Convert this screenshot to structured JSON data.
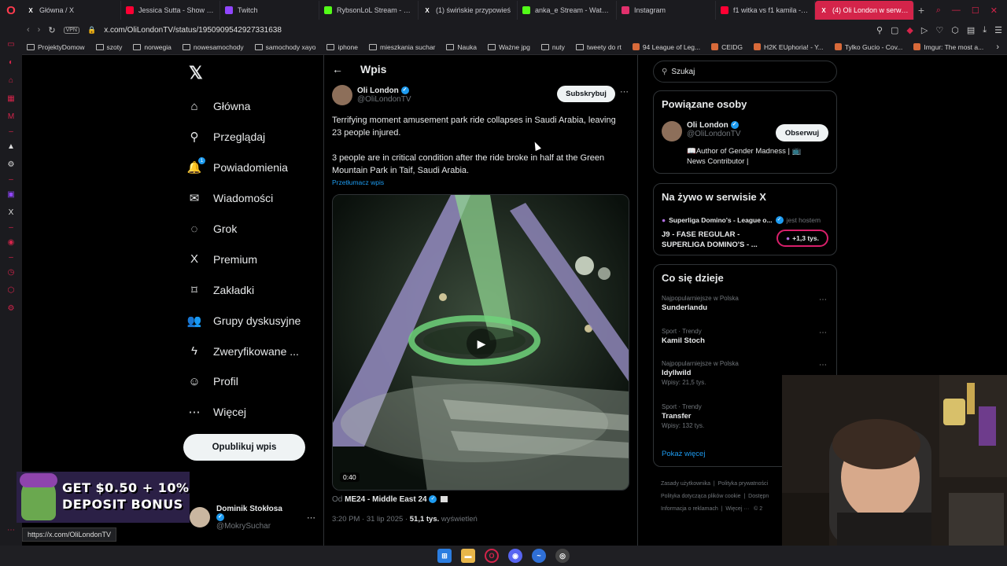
{
  "browser": {
    "tabs": [
      {
        "label": "Główna / X",
        "icon": "x-logo-icon",
        "color": "#ffffff",
        "active": false
      },
      {
        "label": "Jessica Sutta - Show Me",
        "icon": "youtube-icon",
        "color": "#ff0033",
        "active": false
      },
      {
        "label": "Twitch",
        "icon": "twitch-icon",
        "color": "#9146ff",
        "active": false
      },
      {
        "label": "RybsonLoL Stream - Wat",
        "icon": "kick-icon",
        "color": "#53fc18",
        "active": false
      },
      {
        "label": "(1) świńskie przypowieś",
        "icon": "x-logo-icon",
        "color": "#ffffff",
        "active": false
      },
      {
        "label": "anka_e Stream - Watch L",
        "icon": "kick-icon",
        "color": "#53fc18",
        "active": false
      },
      {
        "label": "Instagram",
        "icon": "instagram-icon",
        "color": "#e1306c",
        "active": false
      },
      {
        "label": "f1 witka vs f1 kamila - Yo",
        "icon": "youtube-icon",
        "color": "#ff0033",
        "active": false
      },
      {
        "label": "(4) Oli London w serwisie",
        "icon": "x-logo-icon",
        "color": "#ffffff",
        "active": true
      }
    ],
    "vpn_label": "VPN",
    "url": "x.com/OliLondonTV/status/1950909542927331638",
    "bookmarks": [
      {
        "label": "ProjektyDomow",
        "type": "folder"
      },
      {
        "label": "szoty",
        "type": "folder"
      },
      {
        "label": "norwegia",
        "type": "folder"
      },
      {
        "label": "nowesamochody",
        "type": "folder"
      },
      {
        "label": "samochody xayo",
        "type": "folder"
      },
      {
        "label": "iphone",
        "type": "folder"
      },
      {
        "label": "mieszkania suchar",
        "type": "folder"
      },
      {
        "label": "Nauka",
        "type": "folder"
      },
      {
        "label": "Ważne jpg",
        "type": "folder"
      },
      {
        "label": "nuty",
        "type": "folder"
      },
      {
        "label": "tweety do rt",
        "type": "folder"
      },
      {
        "label": "94 League of Leg...",
        "type": "site"
      },
      {
        "label": "CEIDG",
        "type": "site"
      },
      {
        "label": "H2K EUphoria! - Y...",
        "type": "site"
      },
      {
        "label": "Tylko Gucio - Cov...",
        "type": "site"
      },
      {
        "label": "Imgur: The most a...",
        "type": "site"
      }
    ],
    "status_link": "https://x.com/OliLondonTV"
  },
  "nav": {
    "items": [
      {
        "label": "Główna",
        "icon": "home-icon",
        "glyph": "⌂"
      },
      {
        "label": "Przeglądaj",
        "icon": "search-icon",
        "glyph": "⚲"
      },
      {
        "label": "Powiadomienia",
        "icon": "bell-icon",
        "glyph": "🔔",
        "badge": "1"
      },
      {
        "label": "Wiadomości",
        "icon": "mail-icon",
        "glyph": "✉"
      },
      {
        "label": "Grok",
        "icon": "grok-icon",
        "glyph": "◌"
      },
      {
        "label": "Premium",
        "icon": "x-premium-icon",
        "glyph": "X"
      },
      {
        "label": "Zakładki",
        "icon": "bookmark-icon",
        "glyph": "⌑"
      },
      {
        "label": "Grupy dyskusyjne",
        "icon": "communities-icon",
        "glyph": "👥"
      },
      {
        "label": "Zweryfikowane ...",
        "icon": "lightning-icon",
        "glyph": "ϟ"
      },
      {
        "label": "Profil",
        "icon": "profile-icon",
        "glyph": "☺"
      },
      {
        "label": "Więcej",
        "icon": "more-circle-icon",
        "glyph": "⋯"
      }
    ],
    "post_button": "Opublikuj wpis",
    "account": {
      "name": "Dominik Stokłosa",
      "handle": "@MokrySuchar"
    }
  },
  "post": {
    "header_title": "Wpis",
    "author_name": "Oli London",
    "author_handle": "@OliLondonTV",
    "subscribe_label": "Subskrybuj",
    "text1": "Terrifying moment amusement park ride collapses in Saudi Arabia, leaving 23 people injured.",
    "text2": "3 people are in critical condition after the ride broke in half at the Green Mountain Park in Taif, Saudi Arabia.",
    "translate_label": "Przetłumacz wpis",
    "video_duration": "0:40",
    "source_prefix": "Od",
    "source_name": "ME24 - Middle East 24",
    "time": "3:20 PM · 31 lip 2025 ·",
    "views_count": "51,1 tys.",
    "views_label": "wyświetleń"
  },
  "sidebar": {
    "search_placeholder": "Szukaj",
    "related": {
      "title": "Powiązane osoby",
      "name": "Oli London",
      "handle": "@OliLondonTV",
      "follow_label": "Obserwuj",
      "bio": "📖Author of Gender Madness | 📺 News Contributor |"
    },
    "live": {
      "title": "Na żywo w serwisie X",
      "host": "Superliga Domino's - League o...",
      "host_suffix": "jest hostem",
      "event": "J9 - FASE REGULAR - SUPERLIGA DOMINO'S - ...",
      "listeners": "+1,3 tys."
    },
    "trends": {
      "title": "Co się dzieje",
      "items": [
        {
          "category": "Najpopularniejsze w Polska",
          "name": "Sunderlandu",
          "count": ""
        },
        {
          "category": "Sport · Trendy",
          "name": "Kamil Stoch",
          "count": ""
        },
        {
          "category": "Najpopularniejsze w Polska",
          "name": "Idyllwild",
          "count": "Wpisy: 21,5 tys."
        },
        {
          "category": "Sport · Trendy",
          "name": "Transfer",
          "count": "Wpisy: 132 tys."
        }
      ],
      "show_more": "Pokaż więcej"
    },
    "footer": {
      "line1a": "Zasady użytkownika",
      "line1b": "Polityka prywatności",
      "line2a": "Polityka dotycząca plików cookie",
      "line2b": "Dostępn",
      "line3a": "Informacja o reklamach",
      "line3b": "Więcej ···",
      "line3c": "© 2"
    }
  },
  "ad": {
    "line1": "GET $0.50 + 10%",
    "line2": "DEPOSIT BONUS"
  },
  "colors": {
    "accent": "#1d9bf0",
    "opera_red": "#d4244a",
    "live_pink": "#d81f6a"
  }
}
